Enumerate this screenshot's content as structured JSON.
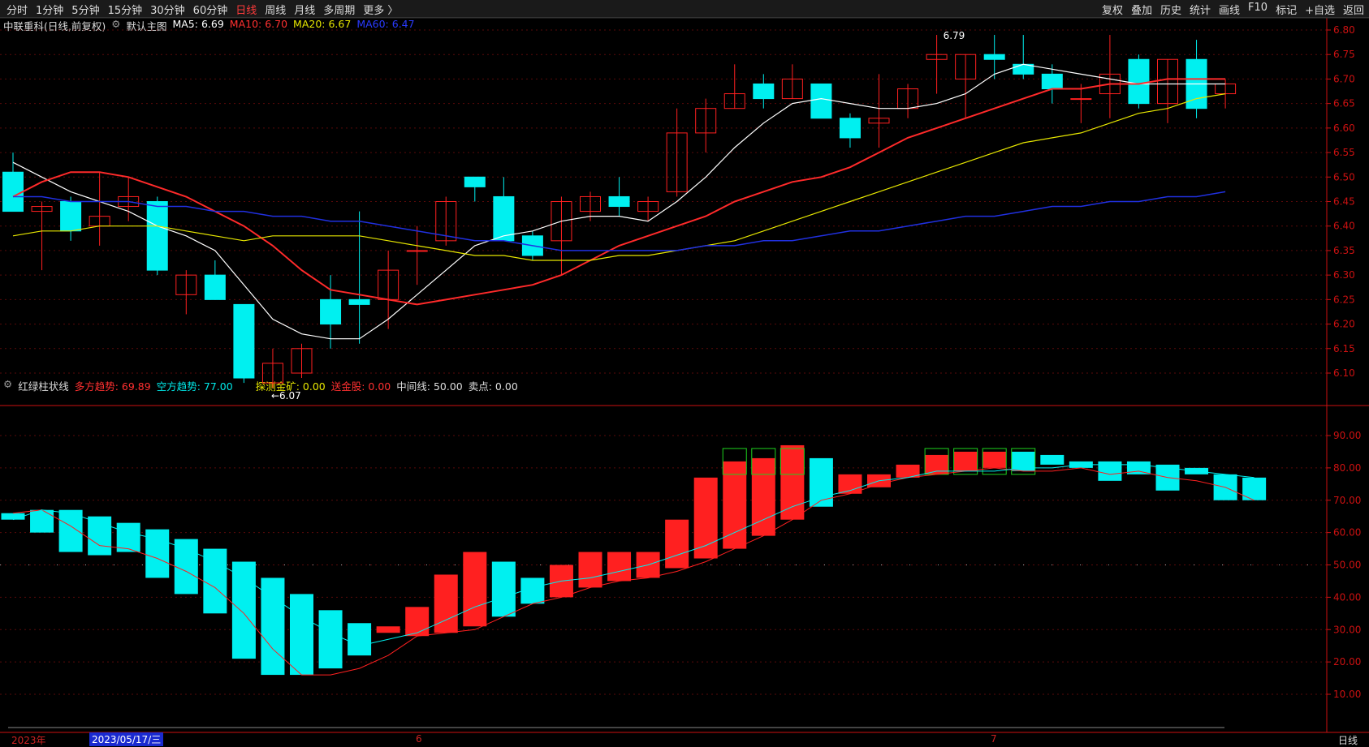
{
  "toolbar": {
    "periods": [
      "分时",
      "1分钟",
      "5分钟",
      "15分钟",
      "30分钟",
      "60分钟",
      "日线",
      "周线",
      "月线",
      "多周期",
      "更多 〉"
    ],
    "active_period": "日线",
    "actions": [
      "复权",
      "叠加",
      "历史",
      "统计",
      "画线",
      "F10",
      "标记",
      "+自选",
      "返回"
    ]
  },
  "main_legend": {
    "stock": "中联重科(日线,前复权)",
    "template": "默认主图",
    "ma5": "MA5: 6.69",
    "ma10": "MA10: 6.70",
    "ma20": "MA20: 6.67",
    "ma60": "MA60: 6.47"
  },
  "sub_legend": {
    "name": "红绿柱状线",
    "long": "多方趋势: 69.89",
    "short": "空方趋势: 77.00",
    "probe": "探测金矿: 0.00",
    "gold": "送金股: 0.00",
    "mid": "中间线: 50.00",
    "sell": "卖点: 0.00"
  },
  "bottom": {
    "year": "2023年",
    "date": "2023/05/17/三",
    "m6": "6",
    "m7": "7",
    "period_label": "日线"
  },
  "colors": {
    "up": "#ff2020",
    "down": "#00f0f0",
    "ma5": "#ffffff",
    "ma10": "#ff2a2a",
    "ma20": "#e6e600",
    "ma60": "#2030e0",
    "axis": "#cc1111"
  },
  "chart_data": [
    {
      "type": "candlestick",
      "title": "中联重科(日线,前复权)",
      "ylim": [
        6.05,
        6.82
      ],
      "yticks": [
        "6.10",
        "6.15",
        "6.20",
        "6.25",
        "6.30",
        "6.35",
        "6.40",
        "6.45",
        "6.50",
        "6.55",
        "6.60",
        "6.65",
        "6.70",
        "6.75",
        "6.80"
      ],
      "annotations": [
        {
          "text": "6.79",
          "label": "max"
        },
        {
          "text": "←6.07",
          "label": "min"
        }
      ],
      "candles": [
        {
          "o": 6.51,
          "h": 6.55,
          "l": 6.43,
          "c": 6.43
        },
        {
          "o": 6.43,
          "h": 6.45,
          "l": 6.31,
          "c": 6.44
        },
        {
          "o": 6.45,
          "h": 6.46,
          "l": 6.37,
          "c": 6.39
        },
        {
          "o": 6.4,
          "h": 6.51,
          "l": 6.36,
          "c": 6.42
        },
        {
          "o": 6.44,
          "h": 6.5,
          "l": 6.41,
          "c": 6.46
        },
        {
          "o": 6.45,
          "h": 6.46,
          "l": 6.3,
          "c": 6.31
        },
        {
          "o": 6.26,
          "h": 6.31,
          "l": 6.22,
          "c": 6.3
        },
        {
          "o": 6.3,
          "h": 6.33,
          "l": 6.25,
          "c": 6.25
        },
        {
          "o": 6.24,
          "h": 6.24,
          "l": 6.08,
          "c": 6.09
        },
        {
          "o": 6.08,
          "h": 6.15,
          "l": 6.07,
          "c": 6.12
        },
        {
          "o": 6.1,
          "h": 6.16,
          "l": 6.09,
          "c": 6.15
        },
        {
          "o": 6.25,
          "h": 6.3,
          "l": 6.15,
          "c": 6.2
        },
        {
          "o": 6.25,
          "h": 6.43,
          "l": 6.16,
          "c": 6.24
        },
        {
          "o": 6.25,
          "h": 6.35,
          "l": 6.19,
          "c": 6.31
        },
        {
          "o": 6.35,
          "h": 6.4,
          "l": 6.28,
          "c": 6.35
        },
        {
          "o": 6.37,
          "h": 6.46,
          "l": 6.36,
          "c": 6.45
        },
        {
          "o": 6.5,
          "h": 6.5,
          "l": 6.45,
          "c": 6.48
        },
        {
          "o": 6.46,
          "h": 6.5,
          "l": 6.37,
          "c": 6.37
        },
        {
          "o": 6.38,
          "h": 6.39,
          "l": 6.33,
          "c": 6.34
        },
        {
          "o": 6.37,
          "h": 6.46,
          "l": 6.3,
          "c": 6.45
        },
        {
          "o": 6.43,
          "h": 6.47,
          "l": 6.41,
          "c": 6.46
        },
        {
          "o": 6.46,
          "h": 6.5,
          "l": 6.42,
          "c": 6.44
        },
        {
          "o": 6.43,
          "h": 6.46,
          "l": 6.41,
          "c": 6.45
        },
        {
          "o": 6.47,
          "h": 6.64,
          "l": 6.46,
          "c": 6.59
        },
        {
          "o": 6.59,
          "h": 6.66,
          "l": 6.55,
          "c": 6.64
        },
        {
          "o": 6.64,
          "h": 6.73,
          "l": 6.64,
          "c": 6.67
        },
        {
          "o": 6.69,
          "h": 6.71,
          "l": 6.64,
          "c": 6.66
        },
        {
          "o": 6.66,
          "h": 6.73,
          "l": 6.66,
          "c": 6.7
        },
        {
          "o": 6.69,
          "h": 6.69,
          "l": 6.62,
          "c": 6.62
        },
        {
          "o": 6.62,
          "h": 6.63,
          "l": 6.56,
          "c": 6.58
        },
        {
          "o": 6.61,
          "h": 6.71,
          "l": 6.56,
          "c": 6.62
        },
        {
          "o": 6.64,
          "h": 6.69,
          "l": 6.62,
          "c": 6.68
        },
        {
          "o": 6.74,
          "h": 6.79,
          "l": 6.67,
          "c": 6.75
        },
        {
          "o": 6.7,
          "h": 6.75,
          "l": 6.62,
          "c": 6.75
        },
        {
          "o": 6.75,
          "h": 6.79,
          "l": 6.7,
          "c": 6.74
        },
        {
          "o": 6.73,
          "h": 6.79,
          "l": 6.7,
          "c": 6.71
        },
        {
          "o": 6.71,
          "h": 6.73,
          "l": 6.65,
          "c": 6.68
        },
        {
          "o": 6.66,
          "h": 6.69,
          "l": 6.61,
          "c": 6.66
        },
        {
          "o": 6.67,
          "h": 6.79,
          "l": 6.62,
          "c": 6.71
        },
        {
          "o": 6.74,
          "h": 6.75,
          "l": 6.64,
          "c": 6.65
        },
        {
          "o": 6.65,
          "h": 6.74,
          "l": 6.61,
          "c": 6.74
        },
        {
          "o": 6.74,
          "h": 6.78,
          "l": 6.62,
          "c": 6.64
        },
        {
          "o": 6.67,
          "h": 6.7,
          "l": 6.64,
          "c": 6.69
        }
      ],
      "series": [
        {
          "name": "MA5",
          "values": [
            6.53,
            6.5,
            6.47,
            6.45,
            6.43,
            6.4,
            6.38,
            6.35,
            6.28,
            6.21,
            6.18,
            6.17,
            6.17,
            6.21,
            6.26,
            6.31,
            6.36,
            6.38,
            6.39,
            6.41,
            6.42,
            6.42,
            6.41,
            6.45,
            6.5,
            6.56,
            6.61,
            6.65,
            6.66,
            6.65,
            6.64,
            6.64,
            6.65,
            6.67,
            6.71,
            6.73,
            6.72,
            6.71,
            6.7,
            6.69,
            6.69,
            6.69,
            6.69
          ]
        },
        {
          "name": "MA10",
          "values": [
            6.46,
            6.49,
            6.51,
            6.51,
            6.5,
            6.48,
            6.46,
            6.43,
            6.4,
            6.36,
            6.31,
            6.27,
            6.26,
            6.25,
            6.24,
            6.25,
            6.26,
            6.27,
            6.28,
            6.3,
            6.33,
            6.36,
            6.38,
            6.4,
            6.42,
            6.45,
            6.47,
            6.49,
            6.5,
            6.52,
            6.55,
            6.58,
            6.6,
            6.62,
            6.64,
            6.66,
            6.68,
            6.68,
            6.69,
            6.69,
            6.7,
            6.7,
            6.7
          ]
        },
        {
          "name": "MA20",
          "values": [
            6.38,
            6.39,
            6.39,
            6.4,
            6.4,
            6.4,
            6.39,
            6.38,
            6.37,
            6.38,
            6.38,
            6.38,
            6.38,
            6.37,
            6.36,
            6.35,
            6.34,
            6.34,
            6.33,
            6.33,
            6.33,
            6.34,
            6.34,
            6.35,
            6.36,
            6.37,
            6.39,
            6.41,
            6.43,
            6.45,
            6.47,
            6.49,
            6.51,
            6.53,
            6.55,
            6.57,
            6.58,
            6.59,
            6.61,
            6.63,
            6.64,
            6.66,
            6.67
          ]
        },
        {
          "name": "MA60",
          "values": [
            6.46,
            6.46,
            6.45,
            6.45,
            6.45,
            6.44,
            6.44,
            6.43,
            6.43,
            6.42,
            6.42,
            6.41,
            6.41,
            6.4,
            6.39,
            6.38,
            6.37,
            6.37,
            6.36,
            6.35,
            6.35,
            6.35,
            6.35,
            6.35,
            6.36,
            6.36,
            6.37,
            6.37,
            6.38,
            6.39,
            6.39,
            6.4,
            6.41,
            6.42,
            6.42,
            6.43,
            6.44,
            6.44,
            6.45,
            6.45,
            6.46,
            6.46,
            6.47
          ]
        }
      ]
    },
    {
      "type": "bar",
      "title": "红绿柱状线",
      "ylim": [
        0,
        100
      ],
      "yticks": [
        "10.00",
        "20.00",
        "30.00",
        "40.00",
        "50.00",
        "60.00",
        "70.00",
        "80.00",
        "90.00"
      ],
      "midline": 50,
      "bars": [
        {
          "o": 66,
          "c": 64
        },
        {
          "o": 67,
          "c": 60
        },
        {
          "o": 67,
          "c": 54
        },
        {
          "o": 65,
          "c": 53
        },
        {
          "o": 63,
          "c": 54
        },
        {
          "o": 61,
          "c": 46
        },
        {
          "o": 58,
          "c": 41
        },
        {
          "o": 55,
          "c": 35
        },
        {
          "o": 51,
          "c": 21
        },
        {
          "o": 46,
          "c": 16
        },
        {
          "o": 41,
          "c": 16
        },
        {
          "o": 36,
          "c": 18
        },
        {
          "o": 32,
          "c": 22
        },
        {
          "o": 29,
          "c": 31
        },
        {
          "o": 28,
          "c": 37
        },
        {
          "o": 29,
          "c": 47
        },
        {
          "o": 31,
          "c": 54
        },
        {
          "o": 51,
          "c": 34
        },
        {
          "o": 46,
          "c": 38
        },
        {
          "o": 40,
          "c": 50
        },
        {
          "o": 43,
          "c": 54
        },
        {
          "o": 45,
          "c": 54
        },
        {
          "o": 46,
          "c": 54
        },
        {
          "o": 49,
          "c": 64
        },
        {
          "o": 52,
          "c": 77
        },
        {
          "o": 55,
          "c": 82
        },
        {
          "o": 59,
          "c": 83
        },
        {
          "o": 64,
          "c": 87
        },
        {
          "o": 83,
          "c": 68
        },
        {
          "o": 72,
          "c": 78
        },
        {
          "o": 74,
          "c": 78
        },
        {
          "o": 77,
          "c": 81
        },
        {
          "o": 78,
          "c": 84
        },
        {
          "o": 79,
          "c": 85
        },
        {
          "o": 80,
          "c": 85
        },
        {
          "o": 85,
          "c": 79
        },
        {
          "o": 84,
          "c": 81
        },
        {
          "o": 82,
          "c": 80
        },
        {
          "o": 82,
          "c": 76
        },
        {
          "o": 82,
          "c": 78
        },
        {
          "o": 81,
          "c": 73
        },
        {
          "o": 80,
          "c": 78
        },
        {
          "o": 78,
          "c": 70
        },
        {
          "o": 77,
          "c": 70
        }
      ],
      "series": [
        {
          "name": "多方趋势",
          "values": [
            66,
            67,
            62,
            56,
            55,
            52,
            48,
            43,
            35,
            24,
            16,
            16,
            18,
            22,
            28,
            29,
            30,
            34,
            38,
            40,
            43,
            45,
            46,
            48,
            51,
            55,
            59,
            64,
            70,
            72,
            75,
            77,
            78,
            79,
            80,
            79,
            79,
            80,
            78,
            79,
            77,
            76,
            74,
            70
          ]
        },
        {
          "name": "空方趋势",
          "values": [
            64,
            67,
            66,
            63,
            60,
            58,
            55,
            51,
            46,
            40,
            34,
            29,
            25,
            27,
            29,
            33,
            37,
            40,
            43,
            45,
            46,
            48,
            50,
            53,
            56,
            60,
            64,
            68,
            71,
            73,
            76,
            77,
            79,
            79,
            79,
            80,
            80,
            81,
            81,
            81,
            80,
            79,
            78,
            77
          ]
        }
      ]
    }
  ]
}
